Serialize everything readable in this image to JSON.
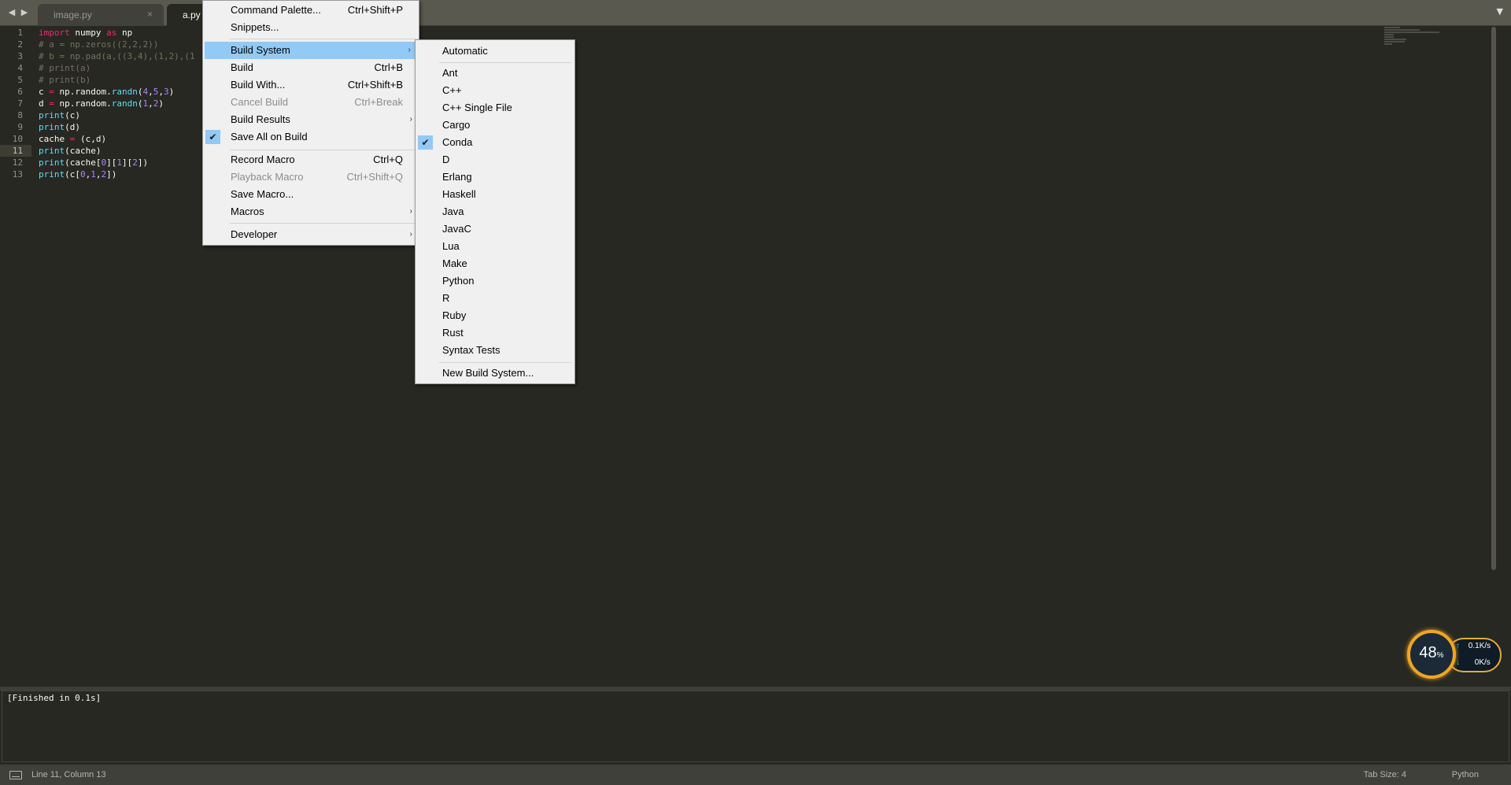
{
  "tabs": [
    {
      "label": "image.py",
      "close": "×"
    },
    {
      "label": "a.py"
    }
  ],
  "nav": {
    "back": "◀",
    "forward": "▶",
    "dropdown": "▼"
  },
  "editor": {
    "line_numbers": [
      "1",
      "2",
      "3",
      "4",
      "5",
      "6",
      "7",
      "8",
      "9",
      "10",
      "11",
      "12",
      "13"
    ],
    "lines": [
      "import numpy as np",
      "# a = np.zeros((2,2,2))",
      "# b = np.pad(a,((3,4),(1,2),(1",
      "# print(a)",
      "# print(b)",
      "c = np.random.randn(4,5,3)",
      "d = np.random.randn(1,2)",
      "print(c)",
      "print(d)",
      "cache = (c,d)",
      "print(cache)",
      "print(cache[0][1][2])",
      "print(c[0,1,2])"
    ],
    "current_line": 11
  },
  "output": {
    "text": "[Finished in 0.1s]"
  },
  "status": {
    "position": "Line 11, Column 13",
    "tab_size": "Tab Size: 4",
    "syntax": "Python"
  },
  "tools_menu": {
    "items": [
      {
        "label": "Command Palette...",
        "shortcut": "Ctrl+Shift+P"
      },
      {
        "label": "Snippets..."
      },
      {
        "label": "Build System",
        "arrow": "›"
      },
      {
        "label": "Build",
        "shortcut": "Ctrl+B"
      },
      {
        "label": "Build With...",
        "shortcut": "Ctrl+Shift+B"
      },
      {
        "label": "Cancel Build",
        "shortcut": "Ctrl+Break"
      },
      {
        "label": "Build Results",
        "arrow": "›"
      },
      {
        "label": "Save All on Build",
        "check": "✔"
      },
      {
        "label": "Record Macro",
        "shortcut": "Ctrl+Q"
      },
      {
        "label": "Playback Macro",
        "shortcut": "Ctrl+Shift+Q"
      },
      {
        "label": "Save Macro..."
      },
      {
        "label": "Macros",
        "arrow": "›"
      },
      {
        "label": "Developer",
        "arrow": "›"
      }
    ]
  },
  "build_menu": {
    "items": [
      {
        "label": "Automatic"
      },
      {
        "label": "Ant"
      },
      {
        "label": "C++"
      },
      {
        "label": "C++ Single File"
      },
      {
        "label": "Cargo"
      },
      {
        "label": "Conda",
        "check": "✔"
      },
      {
        "label": "D"
      },
      {
        "label": "Erlang"
      },
      {
        "label": "Haskell"
      },
      {
        "label": "Java"
      },
      {
        "label": "JavaC"
      },
      {
        "label": "Lua"
      },
      {
        "label": "Make"
      },
      {
        "label": "Python"
      },
      {
        "label": "R"
      },
      {
        "label": "Ruby"
      },
      {
        "label": "Rust"
      },
      {
        "label": "Syntax Tests"
      },
      {
        "label": "New Build System..."
      }
    ]
  },
  "network": {
    "percent": "48",
    "percent_unit": "%",
    "up_arrow": "↑",
    "down_arrow": "↓",
    "upload": "0.1",
    "upload_unit": "K/s",
    "download": "0",
    "download_unit": "K/s"
  },
  "colors": {
    "menu_highlight": "#91c9f7",
    "editor_bg": "#272822",
    "keyword": "#f92672",
    "comment": "#75715e",
    "function": "#66d9ef",
    "number": "#ae81ff",
    "gauge": "#f0a623"
  }
}
